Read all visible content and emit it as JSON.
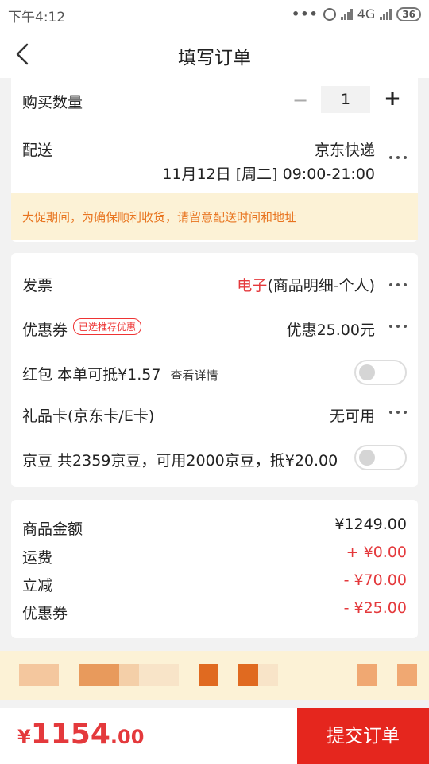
{
  "statusbar": {
    "time": "下午4:12",
    "dots": "•••",
    "network": "4G",
    "battery": "36"
  },
  "header": {
    "title": "填写订单"
  },
  "quantity": {
    "label": "购买数量",
    "minus": "−",
    "value": "1",
    "plus": "+"
  },
  "delivery": {
    "label": "配送",
    "carrier": "京东快递",
    "time": "11月12日 [周二] 09:00-21:00"
  },
  "notice": "大促期间，为确保顺利收货，请留意配送时间和地址",
  "invoice": {
    "label": "发票",
    "type_highlight": "电子",
    "type_rest": "(商品明细-个人)"
  },
  "coupon": {
    "label": "优惠券",
    "tag": "已选推荐优惠",
    "value": "优惠25.00元"
  },
  "red_packet": {
    "label": "红包",
    "desc": "本单可抵¥1.57",
    "link": "查看详情",
    "enabled": false
  },
  "gift_card": {
    "label": "礼品卡(京东卡/E卡)",
    "value": "无可用"
  },
  "jd_beans": {
    "label": "京豆 共2359京豆，可用2000京豆，抵¥20.00",
    "enabled": false
  },
  "summary": {
    "items": [
      {
        "label": "商品金额",
        "value": "¥1249.00",
        "color": "#222222"
      },
      {
        "label": "运费",
        "value": "+ ¥0.00",
        "color": "#e4393c"
      },
      {
        "label": "立减",
        "value": "- ¥70.00",
        "color": "#e4393c"
      },
      {
        "label": "优惠券",
        "value": "- ¥25.00",
        "color": "#e4393c"
      }
    ]
  },
  "bottom": {
    "currency": "¥",
    "total_int": "1154",
    "total_dec": ".00",
    "submit": "提交订单"
  },
  "colors": {
    "accent": "#e4393c",
    "submit_bg": "#e5261e",
    "notice_bg": "#fcf2d6",
    "notice_text": "#e8741f"
  }
}
